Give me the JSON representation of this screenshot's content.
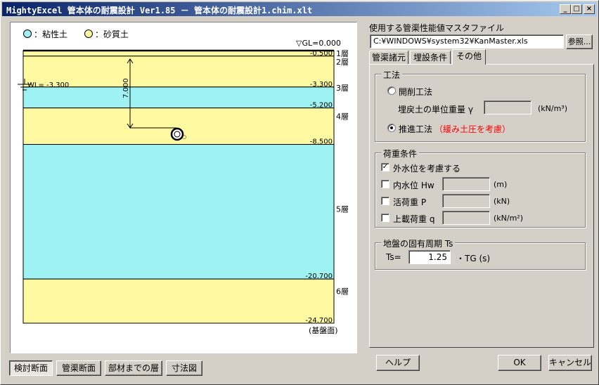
{
  "window": {
    "title": "MightyExcel 管本体の耐震設計 Ver1.85  －  管本体の耐震設計1.chim.xlt",
    "minimize": "_",
    "maximize": "□",
    "close": "×"
  },
  "legend": {
    "clay_label": "：粘性土",
    "sand_label": "：砂質土",
    "clay_color": "#9ef2f2",
    "sand_color": "#fffaa2"
  },
  "section": {
    "gl_label": "▽GL=0.000",
    "wl_label": "WL= -3.300",
    "cover_label": "7.000",
    "bedrock_label": "(基盤面)",
    "boundaries": [
      "-0.500",
      "-3.300",
      "-5.200",
      "-8.500",
      "-20.700",
      "-24.700"
    ],
    "layers": [
      {
        "name": "1層",
        "type": "sand",
        "top": 0.0,
        "bottom": 0.5
      },
      {
        "name": "2層",
        "type": "sand",
        "top": 0.5,
        "bottom": 3.3
      },
      {
        "name": "3層",
        "type": "clay",
        "top": 3.3,
        "bottom": 5.2
      },
      {
        "name": "4層",
        "type": "sand",
        "top": 5.2,
        "bottom": 8.5
      },
      {
        "name": "5層",
        "type": "clay",
        "top": 8.5,
        "bottom": 20.7
      },
      {
        "name": "6層",
        "type": "sand",
        "top": 20.7,
        "bottom": 24.7
      }
    ]
  },
  "view_buttons": [
    "検討断面",
    "管渠断面",
    "部材までの層",
    "寸法図"
  ],
  "master": {
    "label": "使用する管渠性能値マスタファイル",
    "path": "C:¥WINDOWS¥system32¥KanMaster.xls",
    "browse": "参照..."
  },
  "tabs": [
    "管渠諸元",
    "埋設条件",
    "その他"
  ],
  "construction": {
    "group": "工法",
    "open_cut": "開削工法",
    "backfill_label": "埋戻土の単位重量 γ",
    "backfill_value": "",
    "backfill_unit": "(kN/m³)",
    "jacking": "推進工法",
    "jacking_note": "（緩み土圧を考慮）"
  },
  "load": {
    "group": "荷重条件",
    "external_water": "外水位を考慮する",
    "internal_water": "内水位 Hw",
    "internal_water_value": "",
    "internal_water_unit": "(m)",
    "live_load": "活荷重 P",
    "live_load_value": "",
    "live_load_unit": "(kN)",
    "surcharge": "上載荷重 q",
    "surcharge_value": "",
    "surcharge_unit": "(kN/m²)"
  },
  "period": {
    "group": "地盤の固有周期 Ts",
    "ts_label": "Ts=",
    "ts_value": "1.25",
    "ts_unit": "・TG (s)"
  },
  "footer": {
    "help": "ヘルプ",
    "ok": "OK",
    "cancel": "キャンセル"
  }
}
